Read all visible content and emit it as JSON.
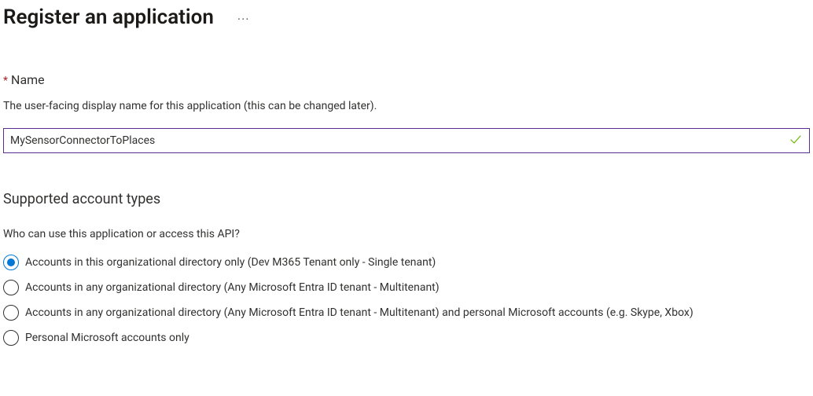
{
  "header": {
    "title": "Register an application"
  },
  "nameSection": {
    "label": "Name",
    "description": "The user-facing display name for this application (this can be changed later).",
    "value": "MySensorConnectorToPlaces"
  },
  "accountTypes": {
    "heading": "Supported account types",
    "question": "Who can use this application or access this API?",
    "selectedIndex": 0,
    "options": [
      {
        "label": "Accounts in this organizational directory only (Dev M365 Tenant only - Single tenant)"
      },
      {
        "label": "Accounts in any organizational directory (Any Microsoft Entra ID tenant - Multitenant)"
      },
      {
        "label": "Accounts in any organizational directory (Any Microsoft Entra ID tenant - Multitenant) and personal Microsoft accounts (e.g. Skype, Xbox)"
      },
      {
        "label": "Personal Microsoft accounts only"
      }
    ]
  }
}
